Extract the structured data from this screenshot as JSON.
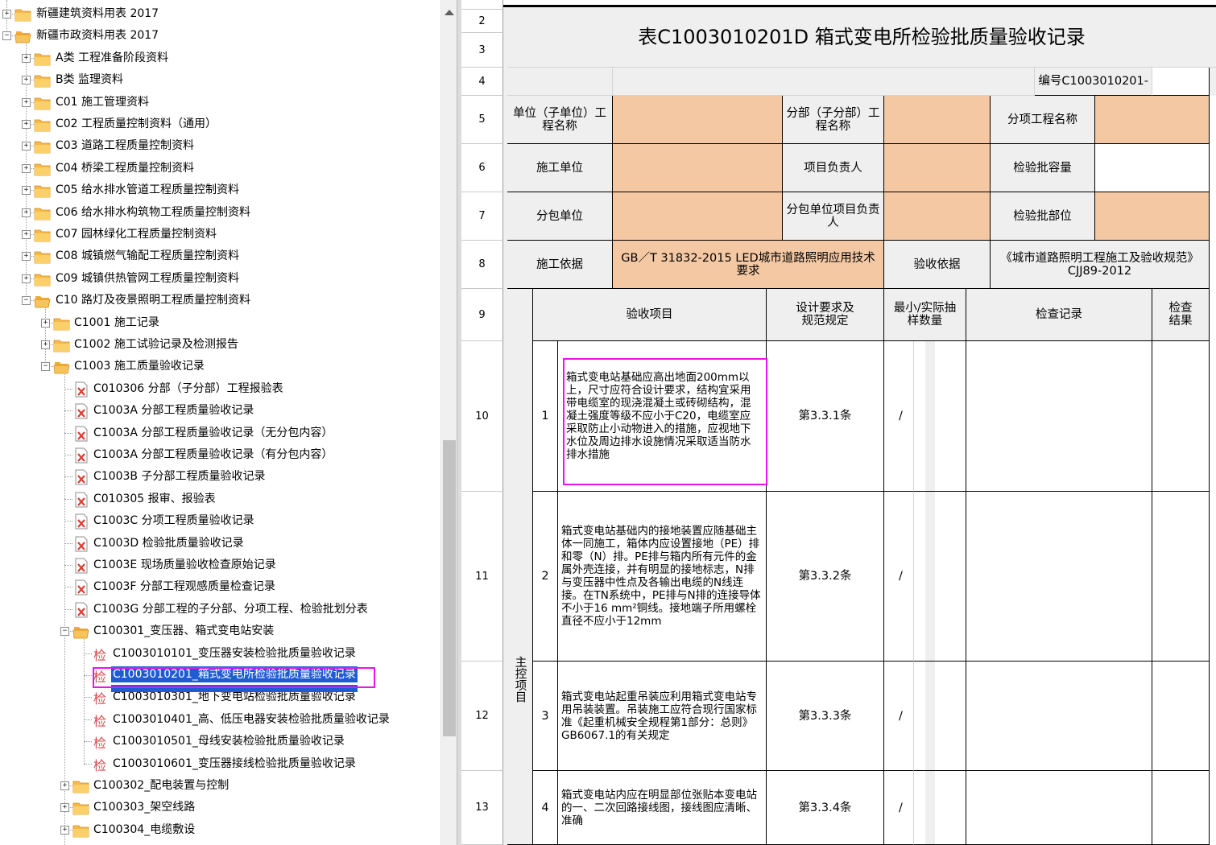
{
  "tree": {
    "items": [
      {
        "label": "新疆建筑资料用表 2017",
        "expander": "+",
        "icon": "folder"
      },
      {
        "label": "新疆市政资料用表 2017",
        "expander": "−",
        "icon": "folder-open"
      },
      {
        "label": "A类 工程准备阶段资料",
        "expander": "+",
        "icon": "folder"
      },
      {
        "label": "B类 监理资料",
        "expander": "+",
        "icon": "folder"
      },
      {
        "label": "C01 施工管理资料",
        "expander": "+",
        "icon": "folder"
      },
      {
        "label": "C02 工程质量控制资料（通用）",
        "expander": "+",
        "icon": "folder"
      },
      {
        "label": "C03 道路工程质量控制资料",
        "expander": "+",
        "icon": "folder"
      },
      {
        "label": "C04 桥梁工程质量控制资料",
        "expander": "+",
        "icon": "folder"
      },
      {
        "label": "C05 给水排水管道工程质量控制资料",
        "expander": "+",
        "icon": "folder"
      },
      {
        "label": "C06 给水排水构筑物工程质量控制资料",
        "expander": "+",
        "icon": "folder"
      },
      {
        "label": "C07 园林绿化工程质量控制资料",
        "expander": "+",
        "icon": "folder"
      },
      {
        "label": "C08 城镇燃气输配工程质量控制资料",
        "expander": "+",
        "icon": "folder"
      },
      {
        "label": "C09 城镇供热管网工程质量控制资料",
        "expander": "+",
        "icon": "folder"
      },
      {
        "label": "C10 路灯及夜景照明工程质量控制资料",
        "expander": "−",
        "icon": "folder-open"
      },
      {
        "label": "C1001 施工记录",
        "expander": "+",
        "icon": "folder"
      },
      {
        "label": "C1002 施工试验记录及检测报告",
        "expander": "+",
        "icon": "folder"
      },
      {
        "label": "C1003 施工质量验收记录",
        "expander": "−",
        "icon": "folder-open"
      },
      {
        "label": "C010306 分部（子分部）工程报验表",
        "expander": "",
        "icon": "document-x"
      },
      {
        "label": "C1003A 分部工程质量验收记录",
        "expander": "",
        "icon": "document-x"
      },
      {
        "label": "C1003A 分部工程质量验收记录（无分包内容）",
        "expander": "",
        "icon": "document-x"
      },
      {
        "label": "C1003A 分部工程质量验收记录（有分包内容）",
        "expander": "",
        "icon": "document-x"
      },
      {
        "label": "C1003B 子分部工程质量验收记录",
        "expander": "",
        "icon": "document-x"
      },
      {
        "label": "C010305 报审、报验表",
        "expander": "",
        "icon": "document-x"
      },
      {
        "label": "C1003C 分项工程质量验收记录",
        "expander": "",
        "icon": "document-x"
      },
      {
        "label": "C1003D 检验批质量验收记录",
        "expander": "",
        "icon": "document-x"
      },
      {
        "label": "C1003E 现场质量验收检查原始记录",
        "expander": "",
        "icon": "document-x"
      },
      {
        "label": "C1003F 分部工程观感质量检查记录",
        "expander": "",
        "icon": "document-x"
      },
      {
        "label": "C1003G 分部工程的子分部、分项工程、检验批划分表",
        "expander": "",
        "icon": "document-x"
      },
      {
        "label": "C100301_变压器、箱式变电站安装",
        "expander": "−",
        "icon": "folder-open"
      },
      {
        "label": "C1003010101_变压器安装检验批质量验收记录",
        "expander": "",
        "icon": "inspect"
      },
      {
        "label": "C1003010201_箱式变电所检验批质量验收记录",
        "expander": "",
        "icon": "inspect"
      },
      {
        "label": "C1003010301_地下变电站检验批质量验收记录",
        "expander": "",
        "icon": "inspect"
      },
      {
        "label": "C1003010401_高、低压电器安装检验批质量验收记录",
        "expander": "",
        "icon": "inspect"
      },
      {
        "label": "C1003010501_母线安装检验批质量验收记录",
        "expander": "",
        "icon": "inspect"
      },
      {
        "label": "C1003010601_变压器接线检验批质量验收记录",
        "expander": "",
        "icon": "inspect"
      },
      {
        "label": "C100302_配电装置与控制",
        "expander": "+",
        "icon": "folder"
      },
      {
        "label": "C100303_架空线路",
        "expander": "+",
        "icon": "folder"
      },
      {
        "label": "C100304_电缆敷设",
        "expander": "+",
        "icon": "folder"
      }
    ],
    "inspect_glyph": "检"
  },
  "sheet": {
    "row_numbers": [
      "2",
      "3",
      "4",
      "5",
      "6",
      "7",
      "8",
      "9",
      "10",
      "11",
      "12",
      "13"
    ],
    "title": "表C1003010201D 箱式变电所检验批质量验收记录",
    "serial": "编号C1003010201-",
    "info": {
      "unit_label": "单位（子单位）工程名称",
      "subdiv_label": "分部（子分部）工程名称",
      "item_label": "分项工程名称",
      "contractor_label": "施工单位",
      "pm_label": "项目负责人",
      "capacity_label": "检验批容量",
      "subcontractor_label": "分包单位",
      "sub_pm_label": "分包单位项目负责人",
      "location_label": "检验批部位",
      "basis_label": "施工依据",
      "basis_value": "GB／T 31832-2015 LED城市道路照明应用技术要求",
      "acceptance_label": "验收依据",
      "acceptance_value": "《城市道路照明工程施工及验收规范》CJJ89-2012"
    },
    "headers": {
      "item": "验收项目",
      "design": "设计要求及规范规定",
      "sample": "最小/实际抽样数量",
      "record": "检查记录",
      "result": "检查结果"
    },
    "main_control": "主控项目",
    "items": [
      {
        "no": "1",
        "text": "箱式变电站基础应高出地面200mm以上，尺寸应符合设计要求，结构宜采用带电缆室的现浇混凝土或砖砌结构，混凝土强度等级不应小于C20，电缆室应采取防止小动物进入的措施，应视地下水位及周边排水设施情况采取适当防水排水措施",
        "clause": "第3.3.1条",
        "sample": "/"
      },
      {
        "no": "2",
        "text": "箱式变电站基础内的接地装置应随基础主体一同施工，箱体内应设置接地（PE）排和零（N）排。PE排与箱内所有元件的金属外壳连接，并有明显的接地标志，N排与变压器中性点及各输出电缆的N线连接。在TN系统中，PE排与N排的连接导体不小于16 mm²铜线。接地端子所用螺栓直径不应小于12mm",
        "clause": "第3.3.2条",
        "sample": "/"
      },
      {
        "no": "3",
        "text": "箱式变电站起重吊装应利用箱式变电站专用吊装装置。吊装施工应符合现行国家标准《起重机械安全规程第1部分：总则》GB6067.1的有关规定",
        "clause": "第3.3.3条",
        "sample": "/"
      },
      {
        "no": "4",
        "text": "箱式变电站内应在明显部位张贴本变电站的一、二次回路接线图，接线图应清晰、准确",
        "clause": "第3.3.4条",
        "sample": "/"
      }
    ]
  },
  "colors": {
    "peach": "#f4c8a3",
    "grey_cell": "#efefef",
    "selection": "#1f5cd4",
    "highlight": "#ec12ec"
  }
}
